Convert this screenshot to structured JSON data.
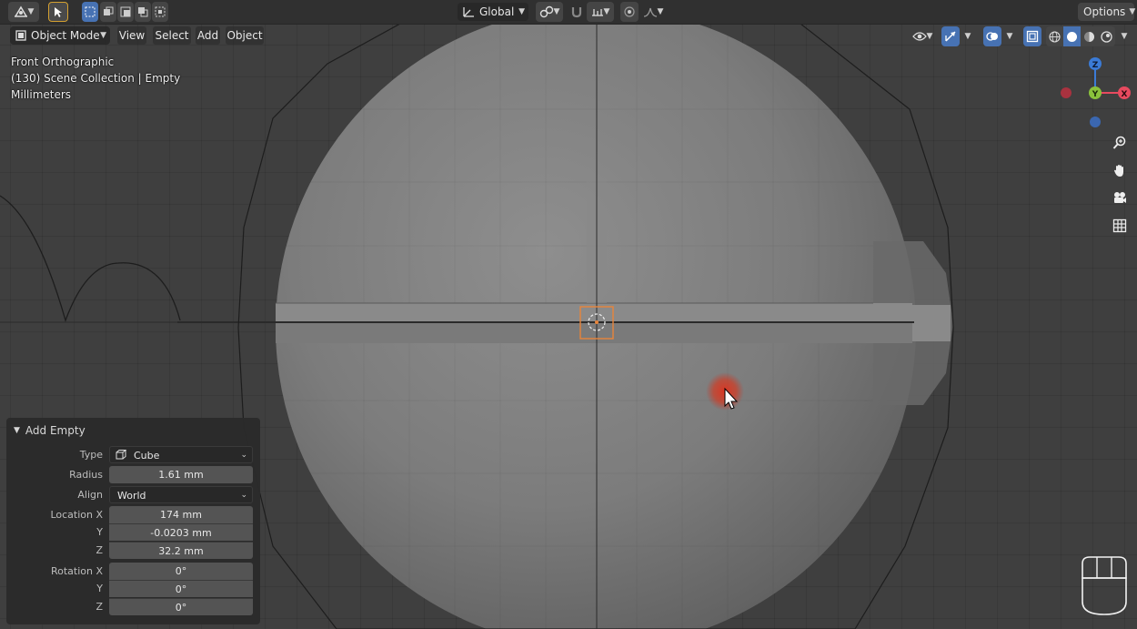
{
  "header": {
    "transform_orientation": "Global",
    "options_label": "Options"
  },
  "viewport_header": {
    "mode": "Object Mode",
    "menus": [
      "View",
      "Select",
      "Add",
      "Object"
    ]
  },
  "overlay": {
    "view_name": "Front Orthographic",
    "collection_info": "(130) Scene Collection | Empty",
    "units": "Millimeters"
  },
  "gizmo": {
    "z_label": "Z",
    "y_label": "Y",
    "x_label": "X"
  },
  "redo_panel": {
    "title": "Add Empty",
    "type_label": "Type",
    "type_value": "Cube",
    "radius_label": "Radius",
    "radius_value": "1.61 mm",
    "align_label": "Align",
    "align_value": "World",
    "location_label": "Location X",
    "location_x": "174 mm",
    "y_label": "Y",
    "location_y": "-0.0203 mm",
    "z_label": "Z",
    "location_z": "32.2 mm",
    "rotation_label": "Rotation X",
    "rotation_x": "0°",
    "rotation_y": "0°",
    "rotation_z": "0°"
  }
}
